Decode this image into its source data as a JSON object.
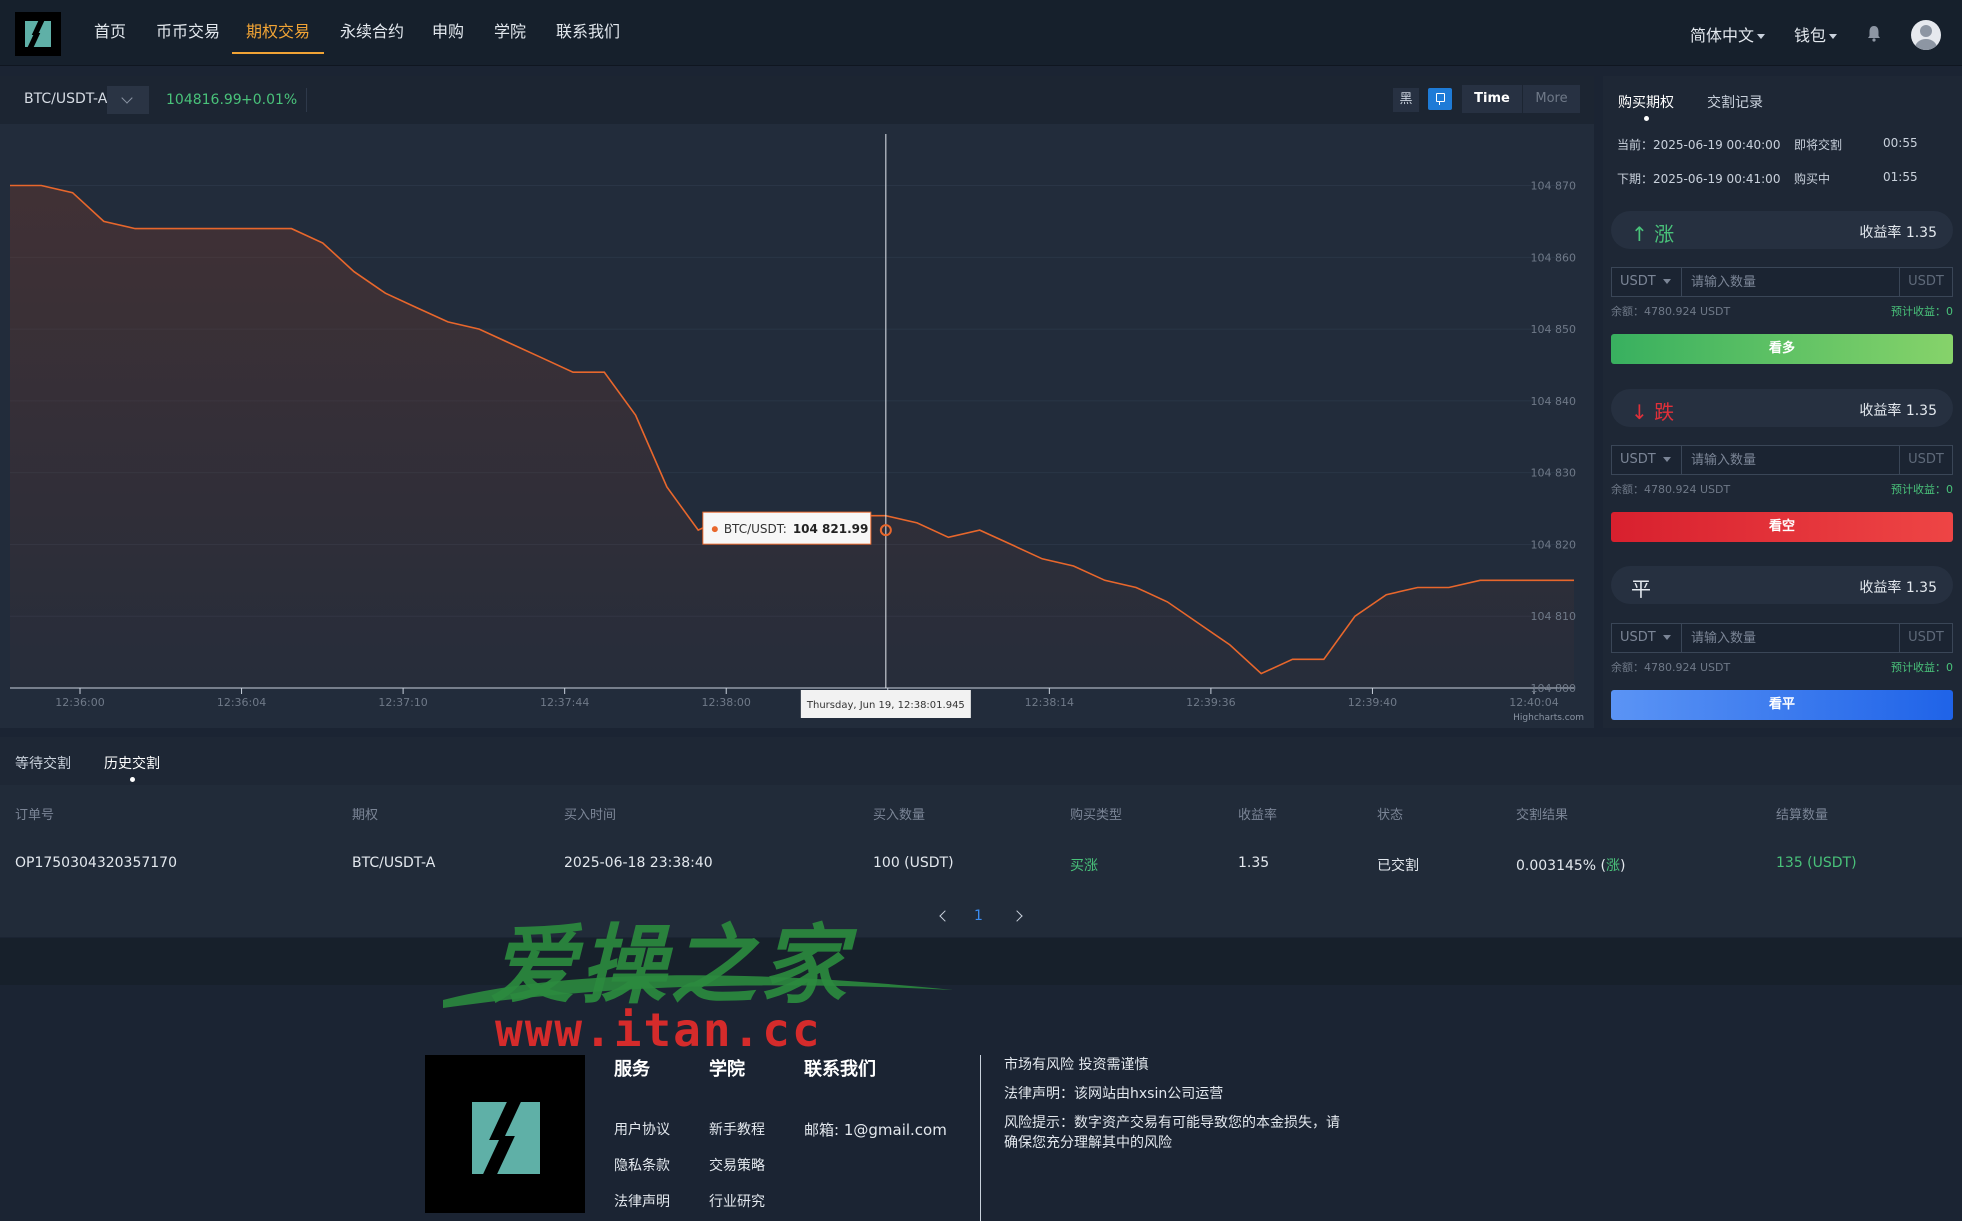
{
  "nav": {
    "items": [
      "首页",
      "币币交易",
      "期权交易",
      "永续合约",
      "申购",
      "学院",
      "联系我们"
    ],
    "active_index": 2,
    "language": "简体中文",
    "wallet": "钱包"
  },
  "chart_header": {
    "symbol": "BTC/USDT-A",
    "price": "104816.99",
    "change": "+0.01%",
    "theme_label": "黑",
    "time_button": "Time",
    "more_button": "More"
  },
  "chart_data": {
    "type": "area",
    "series": [
      {
        "name": "BTC/USDT",
        "values": [
          104870,
          104870,
          104869,
          104865,
          104864,
          104864,
          104864,
          104864,
          104864,
          104864,
          104862,
          104858,
          104855,
          104853,
          104851,
          104850,
          104848,
          104846,
          104844,
          104844,
          104838,
          104828,
          104822,
          104824,
          104824,
          104824,
          104824,
          104824,
          104824,
          104823,
          104821,
          104822,
          104820,
          104818,
          104817,
          104815,
          104814,
          104812,
          104809,
          104806,
          104802,
          104804,
          104804,
          104810,
          104813,
          104814,
          104814,
          104815,
          104815,
          104815,
          104815
        ]
      }
    ],
    "x_tick_labels": [
      "12:36:00",
      "12:36:04",
      "12:37:10",
      "12:37:44",
      "12:38:00",
      "12:38:08",
      "12:38:14",
      "12:39:36",
      "12:39:40",
      "12:40:04"
    ],
    "y_tick_labels": [
      "104 870",
      "104 860",
      "104 850",
      "104 840",
      "104 830",
      "104 820",
      "104 810",
      "104 800"
    ],
    "ylim": [
      104800,
      104873
    ],
    "tooltip_series": "BTC/USDT:",
    "tooltip_value": "104 821.99",
    "crosshair_label": "Thursday, Jun 19, 12:38:01.945",
    "credits": "Highcharts.com",
    "line_color": "#e8672c"
  },
  "right_panel": {
    "tabs": [
      "购买期权",
      "交割记录"
    ],
    "current_label": "当前：2025-06-19 00:40:00",
    "current_status": "即将交割",
    "current_time": "00:55",
    "next_label": "下期：2025-06-19 00:41:00",
    "next_status": "购买中",
    "next_time": "01:55",
    "options": [
      {
        "direction": "↑ 涨",
        "yield": "收益率 1.35",
        "currency": "USDT",
        "placeholder": "请输入数量",
        "unit": "USDT",
        "balance": "余额：4780.924 USDT",
        "estimate": "预计收益：0",
        "button": "看多",
        "color": "#49c27a"
      },
      {
        "direction": "↓ 跌",
        "yield": "收益率 1.35",
        "currency": "USDT",
        "placeholder": "请输入数量",
        "unit": "USDT",
        "balance": "余额：4780.924 USDT",
        "estimate": "预计收益：0",
        "button": "看空",
        "color": "#e0303a"
      },
      {
        "direction": "平",
        "yield": "收益率 1.35",
        "currency": "USDT",
        "placeholder": "请输入数量",
        "unit": "USDT",
        "balance": "余额：4780.924 USDT",
        "estimate": "预计收益：0",
        "button": "看平",
        "color": "#e3e8ee"
      }
    ]
  },
  "orders": {
    "tabs": [
      "等待交割",
      "历史交割"
    ],
    "active_tab": 1,
    "columns": [
      "订单号",
      "期权",
      "买入时间",
      "买入数量",
      "购买类型",
      "收益率",
      "状态",
      "交割结果",
      "结算数量"
    ],
    "rows": [
      [
        "OP1750304320357170",
        "BTC/USDT-A",
        "2025-06-18 23:38:40",
        "100 (USDT)",
        "买涨",
        "1.35",
        "已交割",
        "0.003145% (",
        "涨",
        ")",
        "135 (USDT)"
      ]
    ],
    "page": "1"
  },
  "footer": {
    "col1_title": "服务",
    "col1_links": [
      "用户协议",
      "隐私条款",
      "法律声明"
    ],
    "col2_title": "学院",
    "col2_links": [
      "新手教程",
      "交易策略",
      "行业研究"
    ],
    "col3_title": "联系我们",
    "email": "邮箱: 1@gmail.com",
    "risk_title": "市场有风险 投资需谨慎",
    "legal": "法律声明：该网站由hxsin公司运营",
    "risk_line1": "风险提示：数字资产交易有可能导致您的本金损失，请",
    "risk_line2": "确保您充分理解其中的风险"
  },
  "watermark": {
    "line1": "爱操之家",
    "line2": "www.itan.cc"
  },
  "colors": {
    "accent": "#f0a335",
    "up": "#49c27a",
    "down": "#e0303a",
    "flat": "#3b7cf0",
    "chart_line": "#e8672c"
  }
}
